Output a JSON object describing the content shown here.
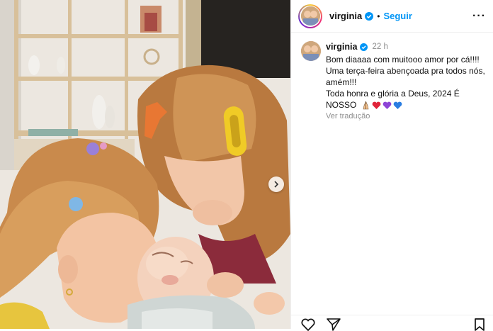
{
  "post": {
    "username": "virginia",
    "follow_label": "Seguir",
    "separator": "•",
    "more_label": "···"
  },
  "caption": {
    "username": "virginia",
    "time": "22 h",
    "lines": [
      "Bom diaaaa com muitooo amor por cá!!!!",
      "Uma terça-feira abençoada pra todos nós,",
      "amém!!!",
      "Toda honra e glória a Deus, 2024 É",
      "NOSSO"
    ],
    "emojis": [
      "praying-hands-icon",
      "red-heart-icon",
      "purple-heart-icon",
      "blue-heart-icon"
    ],
    "translate_label": "Ver tradução"
  },
  "colors": {
    "accent": "#0095f6",
    "muted": "#8e8e8e",
    "verified": "#0095f6"
  },
  "icons": {
    "carousel_next": "chevron-right-icon",
    "more": "more-horizontal-icon",
    "like": "heart-outline-icon",
    "share": "paper-plane-icon",
    "save": "bookmark-icon"
  }
}
